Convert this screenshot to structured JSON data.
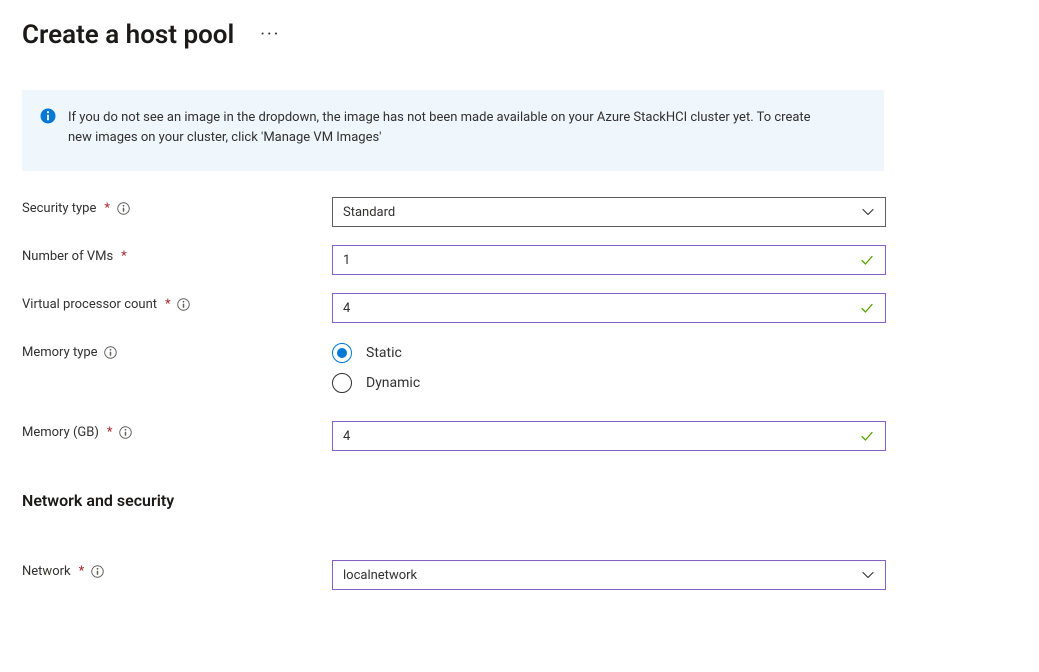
{
  "header": {
    "title": "Create a host pool",
    "more_label": "···"
  },
  "info": {
    "message": "If you do not see an image in the dropdown, the image has not been made available on your Azure StackHCI cluster yet. To create new images on your cluster, click 'Manage VM Images'"
  },
  "form": {
    "security_type": {
      "label": "Security type",
      "value": "Standard"
    },
    "num_vms": {
      "label": "Number of VMs",
      "value": "1"
    },
    "vcpu": {
      "label": "Virtual processor count",
      "value": "4"
    },
    "memory_type": {
      "label": "Memory type",
      "options": {
        "static": "Static",
        "dynamic": "Dynamic"
      },
      "selected": "static"
    },
    "memory_gb": {
      "label": "Memory (GB)",
      "value": "4"
    }
  },
  "section": {
    "network_heading": "Network and security"
  },
  "network": {
    "label": "Network",
    "value": "localnetwork"
  }
}
